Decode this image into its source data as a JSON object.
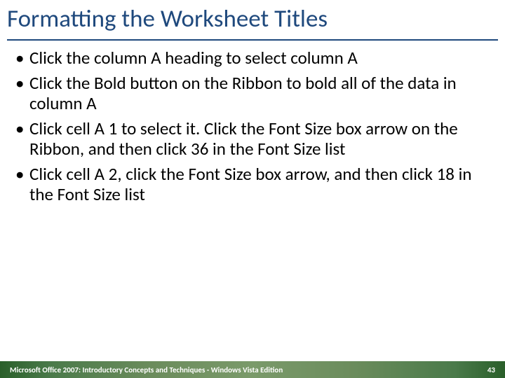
{
  "slide": {
    "title": "Formatting the Worksheet Titles",
    "bullets": [
      "Click the column A heading to select column A",
      "Click the Bold button on the Ribbon to bold all of the data in column A",
      "Click cell A 1 to select it. Click the Font Size box arrow on the Ribbon, and then click 36 in the Font Size list",
      "Click cell A 2, click the Font Size box arrow, and then click 18 in the Font Size list"
    ]
  },
  "footer": {
    "text": "Microsoft Office 2007: Introductory Concepts and Techniques - Windows Vista Edition",
    "page": "43"
  }
}
